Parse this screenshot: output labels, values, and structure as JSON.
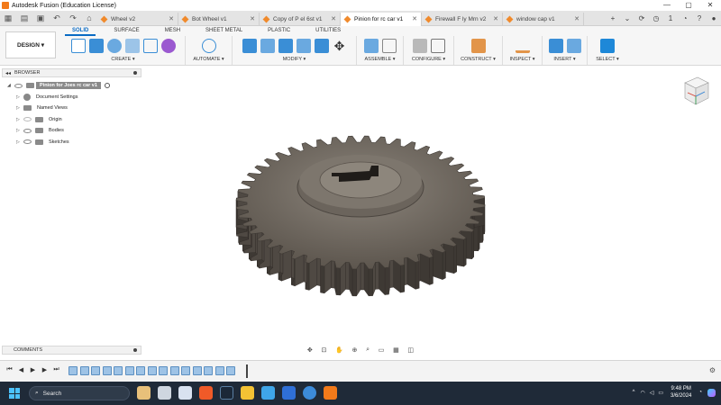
{
  "window": {
    "title": "Autodesk Fusion (Education License)",
    "controls": [
      "—",
      "▢",
      "✕"
    ]
  },
  "tabs": [
    {
      "label": "Wheel v2"
    },
    {
      "label": "Bot Wheel v1"
    },
    {
      "label": "Copy of P   el 6st v1"
    },
    {
      "label": "Pinion for   rc car v1"
    },
    {
      "label": "Firewall F   ly Mrn v2"
    },
    {
      "label": "window cap v1"
    }
  ],
  "tab_right": {
    "count": "1"
  },
  "toolbar": {
    "design_label": "DESIGN ▾",
    "workspace_tabs": [
      "SOLID",
      "SURFACE",
      "MESH",
      "SHEET METAL",
      "PLASTIC",
      "UTILITIES"
    ],
    "groups": [
      {
        "label": "CREATE ▾"
      },
      {
        "label": "AUTOMATE ▾"
      },
      {
        "label": "MODIFY ▾"
      },
      {
        "label": "ASSEMBLE ▾"
      },
      {
        "label": "CONFIGURE ▾"
      },
      {
        "label": "CONSTRUCT ▾"
      },
      {
        "label": "INSPECT ▾"
      },
      {
        "label": "INSERT ▾"
      },
      {
        "label": "SELECT ▾"
      }
    ]
  },
  "browser": {
    "header": "BROWSER",
    "root": "Pinion for Joes rc car v1",
    "items": [
      "Document Settings",
      "Named Views",
      "Origin",
      "Bodies",
      "Sketches"
    ]
  },
  "comments": {
    "label": "COMMENTS"
  },
  "taskbar": {
    "search_placeholder": "Search",
    "time": "9:48 PM",
    "date": "3/6/2024",
    "badge": "1"
  },
  "colors": {
    "accent": "#0a6bc4",
    "gear": "#5d564e",
    "taskbar": "#1f2a38"
  }
}
